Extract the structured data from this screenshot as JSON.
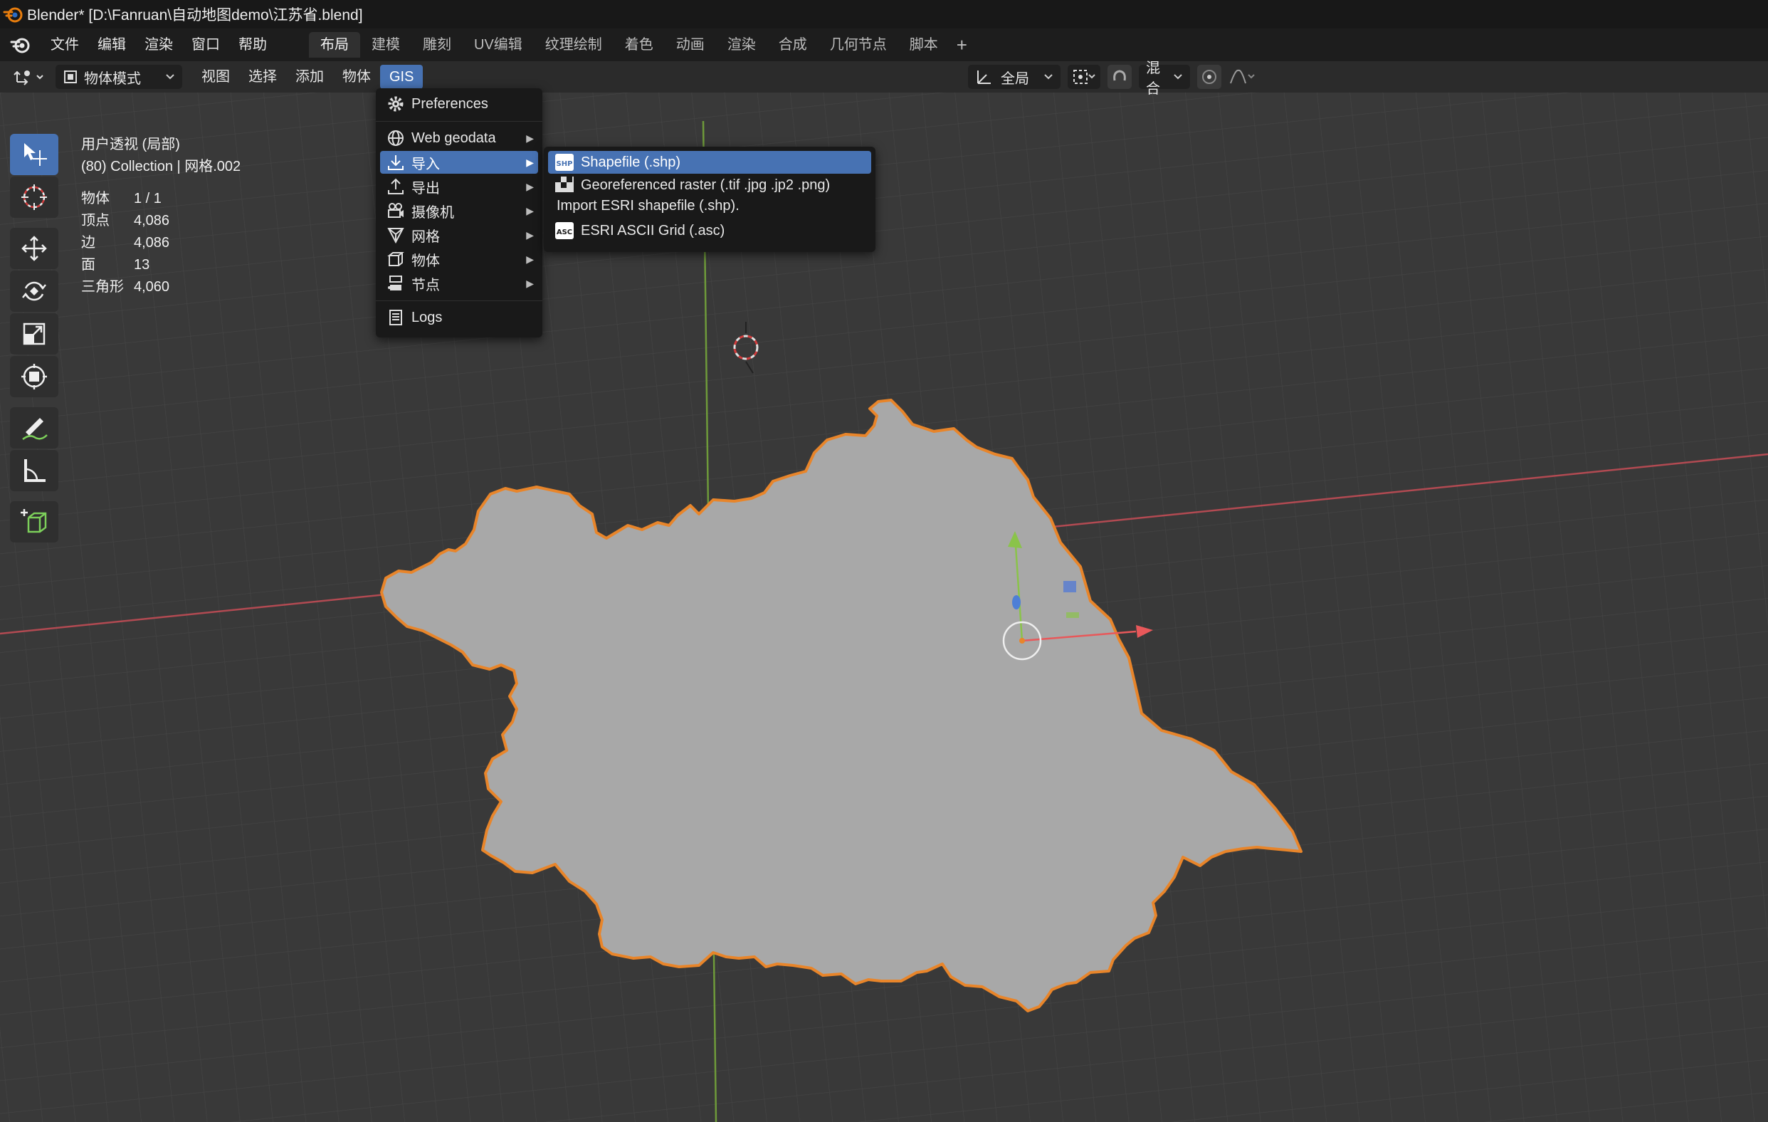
{
  "window": {
    "title": "Blender* [D:\\Fanruan\\自动地图demo\\江苏省.blend]"
  },
  "menubar": {
    "items": [
      "文件",
      "编辑",
      "渲染",
      "窗口",
      "帮助"
    ],
    "workspaces": [
      "布局",
      "建模",
      "雕刻",
      "UV编辑",
      "纹理绘制",
      "着色",
      "动画",
      "渲染",
      "合成",
      "几何节点",
      "脚本"
    ],
    "active_workspace": "布局",
    "add_tab": "+"
  },
  "header": {
    "mode": "物体模式",
    "menus": [
      "视图",
      "选择",
      "添加",
      "物体",
      "GIS"
    ],
    "active_menu": "GIS",
    "orientation": "全局",
    "blend_mode": "混合"
  },
  "viewport_info": {
    "view_name": "用户透视 (局部)",
    "collection": "(80) Collection | 网格.002",
    "stats": [
      {
        "label": "物体",
        "value": "1 / 1"
      },
      {
        "label": "顶点",
        "value": "4,086"
      },
      {
        "label": "边",
        "value": "4,086"
      },
      {
        "label": "面",
        "value": "13"
      },
      {
        "label": "三角形",
        "value": "4,060"
      }
    ]
  },
  "tools": [
    "select-box-icon",
    "cursor-icon",
    "move-icon",
    "rotate-icon",
    "scale-icon",
    "transform-icon",
    "annotate-icon",
    "measure-icon",
    "add-cube-icon"
  ],
  "gis_menu": {
    "items": [
      {
        "label": "Preferences",
        "icon": "gear-icon"
      },
      {
        "label": "Web geodata",
        "icon": "globe-icon",
        "submenu": true
      },
      {
        "label": "导入",
        "icon": "import-icon",
        "submenu": true,
        "active": true
      },
      {
        "label": "导出",
        "icon": "export-icon",
        "submenu": true
      },
      {
        "label": "摄像机",
        "icon": "camera-icon",
        "submenu": true
      },
      {
        "label": "网格",
        "icon": "mesh-icon",
        "submenu": true
      },
      {
        "label": "物体",
        "icon": "object-icon",
        "submenu": true
      },
      {
        "label": "节点",
        "icon": "node-icon",
        "submenu": true
      },
      {
        "label": "Logs",
        "icon": "logs-icon"
      }
    ]
  },
  "import_submenu": {
    "items": [
      {
        "label": "Shapefile (.shp)",
        "icon": "shp-icon",
        "active": true
      },
      {
        "label": "Georeferenced raster (.tif .jpg .jp2 .png)",
        "icon": "raster-icon"
      },
      {
        "label": ")",
        "icon": ""
      },
      {
        "label": "ESRI ASCII Grid (.asc)",
        "icon": "asc-icon"
      }
    ],
    "tooltip": "Import ESRI shapefile (.shp)."
  },
  "colors": {
    "accent": "#4772b3",
    "mesh_fill": "#a8a8a8",
    "selection_outline": "#e8852a",
    "x_axis": "#b24a52",
    "y_axis": "#6e9a3a"
  }
}
